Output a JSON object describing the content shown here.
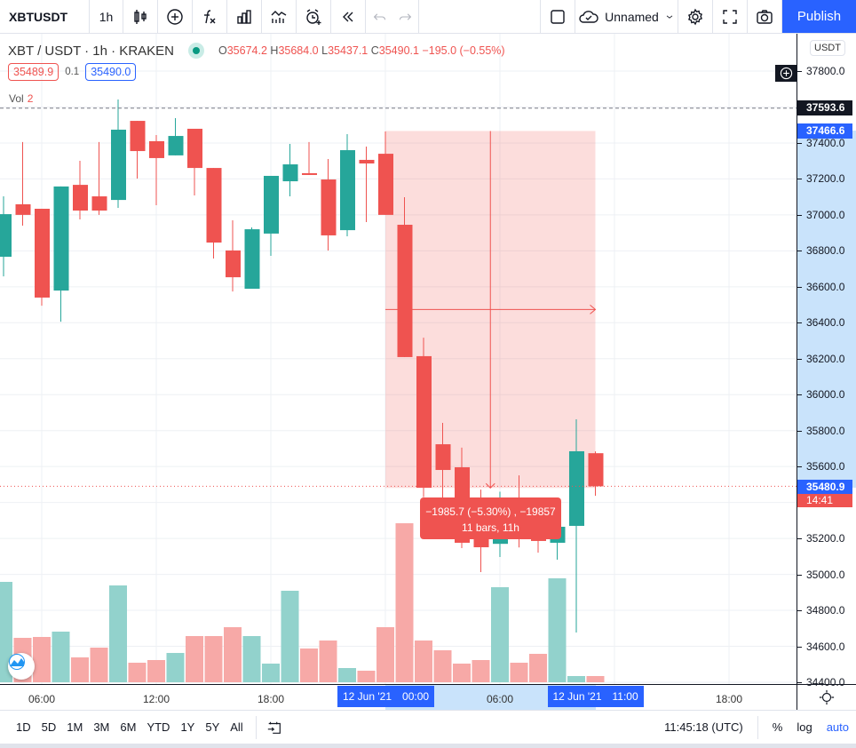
{
  "toolbar": {
    "symbol": "XBTUSDT",
    "interval": "1h",
    "icons": [
      "candles-icon",
      "compare-plus-icon",
      "indicators-fx-icon",
      "templates-icon",
      "replay-chart-icon",
      "alert-icon",
      "rewind-icon",
      "undo-icon",
      "redo-icon"
    ],
    "layout_name": "Unnamed",
    "publish_label": "Publish"
  },
  "legend": {
    "title": "XBT / USDT · 1h · KRAKEN",
    "o_label": "O",
    "o": "35674.2",
    "h_label": "H",
    "h": "35684.0",
    "l_label": "L",
    "l": "35437.1",
    "c_label": "C",
    "c": "35490.1",
    "change": "−195.0 (−0.55%)",
    "bid": "35489.9",
    "spread": "0.1",
    "ask": "35490.0",
    "vol_label": "Vol",
    "vol_value": "2"
  },
  "measure": {
    "line1": "−1985.7 (−5.30%) , −19857",
    "line2": "11 bars, 11h",
    "from_price": 37466.6,
    "to_price": 35480.9,
    "from_time": "2021-06-12 00:00",
    "to_time": "2021-06-12 11:00"
  },
  "price_axis": {
    "currency": "USDT",
    "ticks": [
      "37800.0",
      "37400.0",
      "37200.0",
      "37000.0",
      "36800.0",
      "36600.0",
      "36400.0",
      "36200.0",
      "36000.0",
      "35800.0",
      "35600.0",
      "35200.0",
      "35000.0",
      "34800.0",
      "34600.0",
      "34400.0"
    ],
    "crosshair_price": "37593.6",
    "measure_top_price": "37466.6",
    "last_price": "35480.9",
    "countdown": "14:41"
  },
  "time_axis": {
    "ticks": [
      {
        "t": "2021-06-11 06:00",
        "label": "06:00"
      },
      {
        "t": "2021-06-11 12:00",
        "label": "12:00"
      },
      {
        "t": "2021-06-11 18:00",
        "label": "18:00"
      },
      {
        "t": "2021-06-12 06:00",
        "label": "06:00"
      },
      {
        "t": "2021-06-12 18:00",
        "label": "18:00"
      }
    ],
    "badge_start_date": "12 Jun '21",
    "badge_start_time": "00:00",
    "badge_end_date": "12 Jun '21",
    "badge_end_time": "11:00"
  },
  "bottom_bar": {
    "ranges": [
      "1D",
      "5D",
      "1M",
      "3M",
      "6M",
      "YTD",
      "1Y",
      "5Y",
      "All"
    ],
    "clock": "11:45:18 (UTC)",
    "percent": "%",
    "log": "log",
    "auto": "auto"
  },
  "colors": {
    "up": "#26a69a",
    "down": "#ef5350",
    "vol_up": "#92d2cc",
    "vol_down": "#f7a9a7",
    "accent": "#2962ff",
    "measure_fill": "rgba(239,83,80,0.2)"
  },
  "chart_data": {
    "type": "candlestick",
    "ylim": [
      34400,
      37800
    ],
    "grid": true,
    "crosshair_price": 37593.6,
    "candles": [
      {
        "t": "2021-06-11 04:00",
        "o": 36767,
        "h": 37103,
        "l": 36658,
        "c": 37004,
        "v": 113
      },
      {
        "t": "2021-06-11 05:00",
        "o": 37059,
        "h": 37405,
        "l": 36940,
        "c": 37000,
        "v": 50
      },
      {
        "t": "2021-06-11 06:00",
        "o": 37034,
        "h": 37034,
        "l": 36495,
        "c": 36540,
        "v": 51
      },
      {
        "t": "2021-06-11 07:00",
        "o": 36579,
        "h": 37158,
        "l": 36406,
        "c": 37158,
        "v": 57
      },
      {
        "t": "2021-06-11 08:00",
        "o": 37167,
        "h": 37301,
        "l": 36975,
        "c": 37024,
        "v": 28
      },
      {
        "t": "2021-06-11 09:00",
        "o": 37103,
        "h": 37405,
        "l": 37000,
        "c": 37024,
        "v": 39
      },
      {
        "t": "2021-06-11 10:00",
        "o": 37083,
        "h": 37642,
        "l": 37039,
        "c": 37474,
        "v": 109
      },
      {
        "t": "2021-06-11 11:00",
        "o": 37523,
        "h": 37523,
        "l": 37202,
        "c": 37355,
        "v": 22
      },
      {
        "t": "2021-06-11 12:00",
        "o": 37410,
        "h": 37444,
        "l": 37054,
        "c": 37316,
        "v": 25
      },
      {
        "t": "2021-06-11 13:00",
        "o": 37331,
        "h": 37538,
        "l": 37331,
        "c": 37439,
        "v": 33
      },
      {
        "t": "2021-06-11 14:00",
        "o": 37479,
        "h": 37479,
        "l": 37108,
        "c": 37261,
        "v": 52
      },
      {
        "t": "2021-06-11 15:00",
        "o": 37261,
        "h": 37261,
        "l": 36757,
        "c": 36846,
        "v": 52
      },
      {
        "t": "2021-06-11 16:00",
        "o": 36802,
        "h": 36970,
        "l": 36574,
        "c": 36653,
        "v": 62
      },
      {
        "t": "2021-06-11 17:00",
        "o": 36589,
        "h": 36930,
        "l": 36589,
        "c": 36920,
        "v": 52
      },
      {
        "t": "2021-06-11 18:00",
        "o": 36896,
        "h": 37217,
        "l": 36772,
        "c": 37217,
        "v": 21
      },
      {
        "t": "2021-06-11 19:00",
        "o": 37187,
        "h": 37395,
        "l": 37103,
        "c": 37281,
        "v": 103
      },
      {
        "t": "2021-06-11 20:00",
        "o": 37232,
        "h": 37405,
        "l": 37222,
        "c": 37222,
        "v": 38
      },
      {
        "t": "2021-06-11 21:00",
        "o": 37197,
        "h": 37311,
        "l": 36802,
        "c": 36886,
        "v": 47
      },
      {
        "t": "2021-06-11 22:00",
        "o": 36915,
        "h": 37449,
        "l": 36881,
        "c": 37360,
        "v": 16
      },
      {
        "t": "2021-06-11 23:00",
        "o": 37306,
        "h": 37380,
        "l": 36960,
        "c": 37286,
        "v": 13
      },
      {
        "t": "2021-06-12 00:00",
        "o": 37340,
        "h": 37464,
        "l": 37000,
        "c": 37000,
        "v": 62
      },
      {
        "t": "2021-06-12 01:00",
        "o": 36945,
        "h": 37098,
        "l": 36209,
        "c": 36209,
        "v": 179
      },
      {
        "t": "2021-06-12 02:00",
        "o": 36214,
        "h": 36317,
        "l": 35430,
        "c": 35482,
        "v": 47
      },
      {
        "t": "2021-06-12 03:00",
        "o": 35724,
        "h": 35843,
        "l": 35205,
        "c": 35581,
        "v": 36
      },
      {
        "t": "2021-06-12 04:00",
        "o": 35596,
        "h": 35705,
        "l": 35146,
        "c": 35176,
        "v": 21
      },
      {
        "t": "2021-06-12 05:00",
        "o": 35250,
        "h": 35472,
        "l": 35013,
        "c": 35151,
        "v": 25
      },
      {
        "t": "2021-06-12 06:00",
        "o": 35170,
        "h": 35460,
        "l": 35097,
        "c": 35260,
        "v": 107
      },
      {
        "t": "2021-06-12 07:00",
        "o": 35300,
        "h": 35551,
        "l": 35150,
        "c": 35220,
        "v": 22
      },
      {
        "t": "2021-06-12 08:00",
        "o": 35300,
        "h": 35400,
        "l": 35121,
        "c": 35186,
        "v": 32
      },
      {
        "t": "2021-06-12 09:00",
        "o": 35176,
        "h": 35265,
        "l": 35082,
        "c": 35265,
        "v": 117
      },
      {
        "t": "2021-06-12 10:00",
        "o": 35270,
        "h": 35863,
        "l": 34677,
        "c": 35685,
        "v": 7
      },
      {
        "t": "2021-06-12 11:00",
        "o": 35674.2,
        "h": 35684.0,
        "l": 35437.1,
        "c": 35490.1,
        "v": 7
      }
    ]
  }
}
